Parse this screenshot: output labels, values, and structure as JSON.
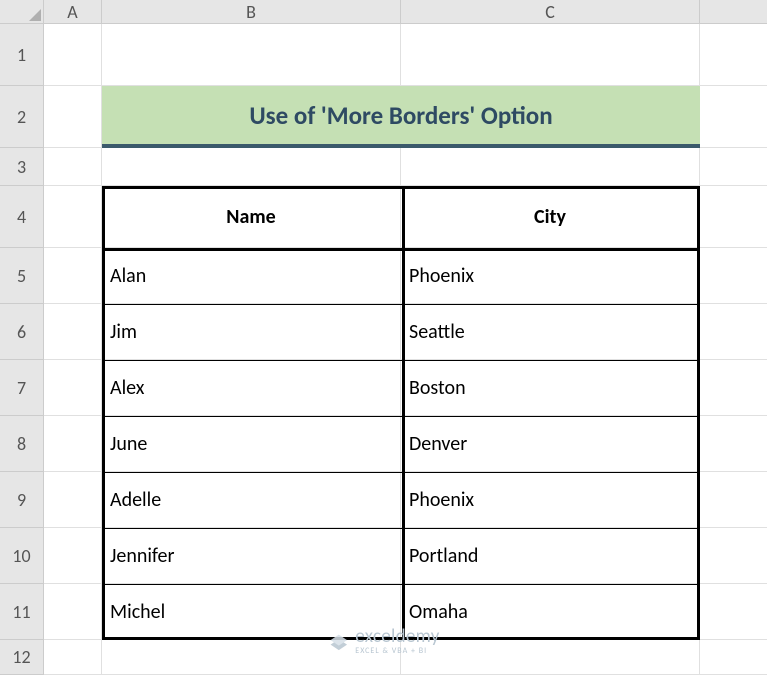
{
  "columns": [
    "",
    "A",
    "B",
    "C",
    ""
  ],
  "rows": [
    "1",
    "2",
    "3",
    "4",
    "5",
    "6",
    "7",
    "8",
    "9",
    "10",
    "11",
    "12"
  ],
  "title": "Use of 'More Borders' Option",
  "headers": {
    "name": "Name",
    "city": "City"
  },
  "data": [
    {
      "name": "Alan",
      "city": "Phoenix"
    },
    {
      "name": "Jim",
      "city": "Seattle"
    },
    {
      "name": "Alex",
      "city": "Boston"
    },
    {
      "name": "June",
      "city": "Denver"
    },
    {
      "name": "Adelle",
      "city": "Phoenix"
    },
    {
      "name": "Jennifer",
      "city": "Portland"
    },
    {
      "name": "Michel",
      "city": "Omaha"
    }
  ],
  "watermark": {
    "brand": "exceldemy",
    "sub": "EXCEL & VBA + BI"
  },
  "chart_data": {
    "type": "table",
    "title": "Use of 'More Borders' Option",
    "columns": [
      "Name",
      "City"
    ],
    "rows": [
      [
        "Alan",
        "Phoenix"
      ],
      [
        "Jim",
        "Seattle"
      ],
      [
        "Alex",
        "Boston"
      ],
      [
        "June",
        "Denver"
      ],
      [
        "Adelle",
        "Phoenix"
      ],
      [
        "Jennifer",
        "Portland"
      ],
      [
        "Michel",
        "Omaha"
      ]
    ]
  }
}
